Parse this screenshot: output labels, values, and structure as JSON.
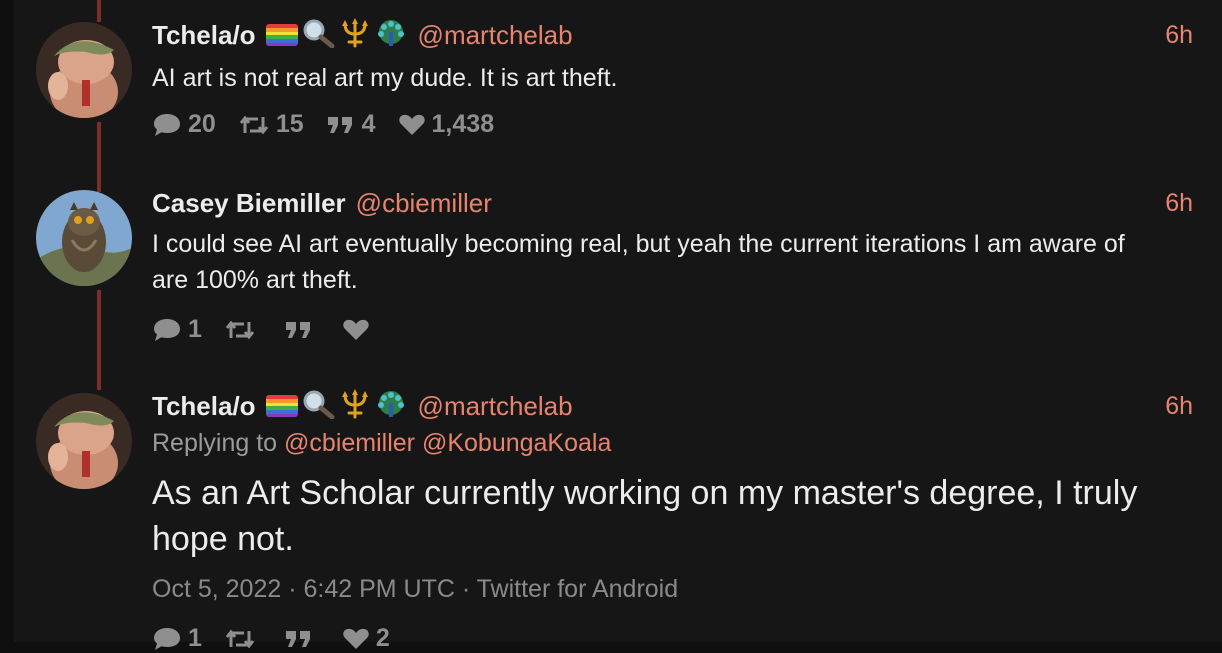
{
  "tweets": [
    {
      "fullname": "Tchela/o",
      "emoji_icons": [
        "rainbow-flag-icon",
        "magnifying-glass-icon",
        "trident-icon",
        "peacock-icon"
      ],
      "username": "@martchelab",
      "time": "6h",
      "text": "AI art is not real art my dude. It is art theft.",
      "stats": {
        "replies": "20",
        "retweets": "15",
        "quotes": "4",
        "likes": "1,438"
      }
    },
    {
      "fullname": "Casey Biemiller",
      "username": "@cbiemiller",
      "time": "6h",
      "text": "I could see AI art eventually becoming real, but yeah the current iterations I am aware of are 100% art theft.",
      "stats": {
        "replies": "1",
        "retweets": "",
        "quotes": "",
        "likes": ""
      }
    },
    {
      "fullname": "Tchela/o",
      "emoji_icons": [
        "rainbow-flag-icon",
        "magnifying-glass-icon",
        "trident-icon",
        "peacock-icon"
      ],
      "username": "@martchelab",
      "time": "6h",
      "replying_prefix": "Replying to",
      "replying_to": [
        "@cbiemiller",
        "@KobungaKoala"
      ],
      "text": "As an Art Scholar currently working on my master's degree, I truly hope not.",
      "meta": "Oct 5, 2022 · 6:42 PM UTC · Twitter for Android",
      "stats": {
        "replies": "1",
        "retweets": "",
        "quotes": "",
        "likes": "2"
      }
    }
  ],
  "colors": {
    "accent": "#e8836e",
    "thread_line": "#7a2e28",
    "text": "#ececec",
    "muted": "#8f8f8f",
    "background": "#161616"
  }
}
